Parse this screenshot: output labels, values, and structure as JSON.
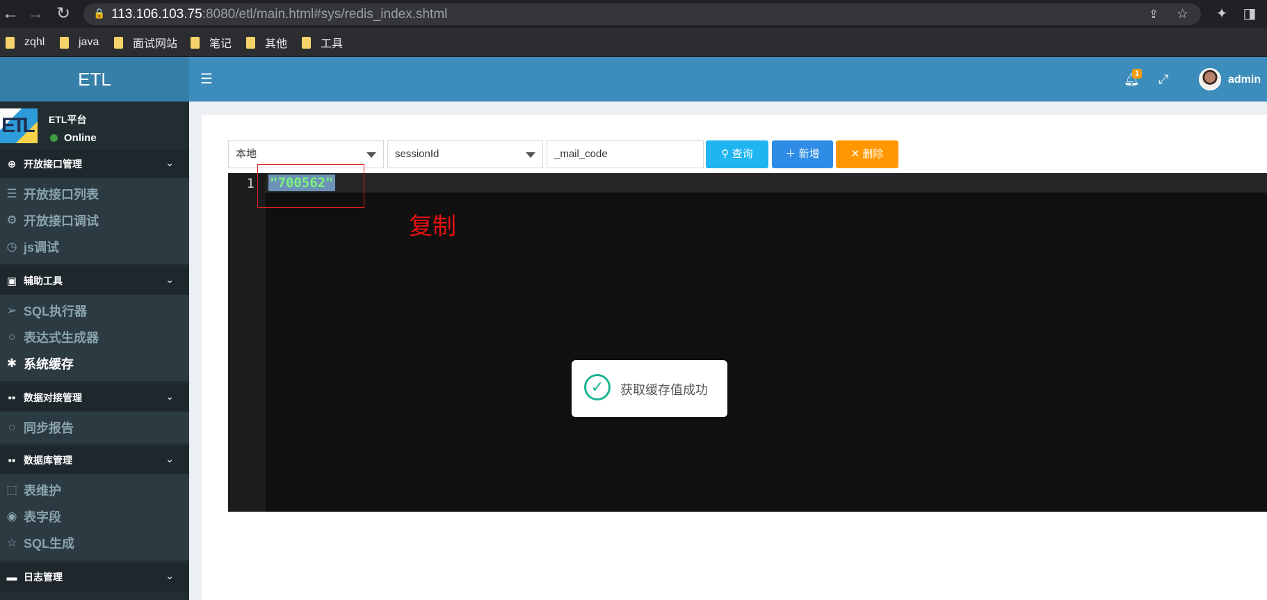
{
  "browser": {
    "url_host": "113.106.103.75",
    "url_rest": ":8080/etl/main.html#sys/redis_index.shtml",
    "bookmarks": [
      "zqhl",
      "java",
      "面试网站",
      "笔记",
      "其他",
      "工具"
    ]
  },
  "app": {
    "logo_text": "ETL",
    "notification_count": "1",
    "user_name": "admin"
  },
  "sidebar": {
    "platform_name": "ETL平台",
    "status": "Online",
    "sections": [
      {
        "label": "开放接口管理",
        "icon": "globe-icon",
        "items": [
          {
            "label": "开放接口列表",
            "icon": "list-icon"
          },
          {
            "label": "开放接口调试",
            "icon": "bug-icon"
          },
          {
            "label": "js调试",
            "icon": "clock-icon"
          }
        ]
      },
      {
        "label": "辅助工具",
        "icon": "money-icon",
        "items": [
          {
            "label": "SQL执行器",
            "icon": "paper-plane-icon"
          },
          {
            "label": "表达式生成器",
            "icon": "circle-icon"
          },
          {
            "label": "系统缓存",
            "icon": "asterisk-icon"
          }
        ]
      },
      {
        "label": "数据对接管理",
        "icon": "vr-icon",
        "items": [
          {
            "label": "同步报告",
            "icon": "comment-icon"
          }
        ]
      },
      {
        "label": "数据库管理",
        "icon": "vr-icon",
        "items": [
          {
            "label": "表维护",
            "icon": "object-group-icon"
          },
          {
            "label": "表字段",
            "icon": "eye-icon"
          },
          {
            "label": "SQL生成",
            "icon": "star-icon"
          }
        ]
      },
      {
        "label": "日志管理",
        "icon": "window-icon",
        "items": []
      }
    ]
  },
  "toolbar": {
    "env_select": "本地",
    "type_select": "sessionId",
    "key_input": "_mail_code",
    "query_label": "查询",
    "add_label": "新增",
    "delete_label": "删除"
  },
  "editor": {
    "line_number": "1",
    "code": "\"700562\""
  },
  "annotation": "复制",
  "toast": {
    "message": "获取缓存值成功"
  },
  "colors": {
    "header": "#3c8dbc",
    "sidebar": "#222d32",
    "query_btn": "#1fb5f0",
    "add_btn": "#2f8ce6",
    "delete_btn": "#ff9800"
  }
}
